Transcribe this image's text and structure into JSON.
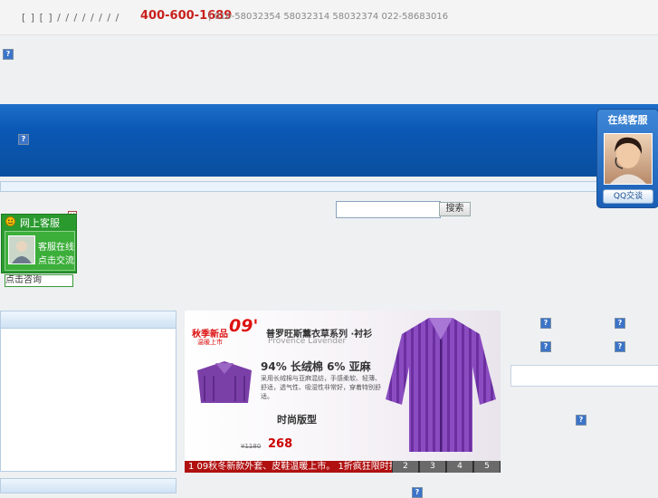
{
  "topbar": {
    "links": "[ ] [ ]  /   / / / / /   /   /",
    "hotline": "400-600-1689",
    "phones": "|  010-58032354 58032314 58032374    022-58683016"
  },
  "broken_icon": "?",
  "search": {
    "button_label": "搜索",
    "placeholder": ""
  },
  "chat_widget": {
    "title": "网上客服",
    "line1": "客服在线",
    "line2": "点击交流",
    "close": "×",
    "consult_button": "点击咨询"
  },
  "ad": {
    "tag_text": "秋季新品",
    "tag_year": "09'",
    "tag_sub": "温暖上市",
    "series_title": "普罗旺斯薰衣草系列 ·衬衫",
    "series_en": "Provence Lavender",
    "fabric_line": "94% 长绒棉  6% 亚麻",
    "desc": "采用长绒棉与亚麻混纺，手感柔软、轻薄、舒适，透气性、吸湿性非常好，穿着特别舒适。",
    "style_label": "时尚版型",
    "price_old": "¥1180",
    "price_new": "268",
    "caption": "1  09秋冬新款外套、皮鞋温暖上市。 1折疯狂限时抢购!",
    "pages": [
      "2",
      "3",
      "4",
      "5"
    ]
  },
  "cs_panel": {
    "title": "在线客服",
    "qq_button": "QQ交谈"
  },
  "colors": {
    "hotline": "#c8201d",
    "banner": "#0a58b5",
    "chat_green": "#2a9a2e",
    "ad_caption": "#b01010"
  }
}
